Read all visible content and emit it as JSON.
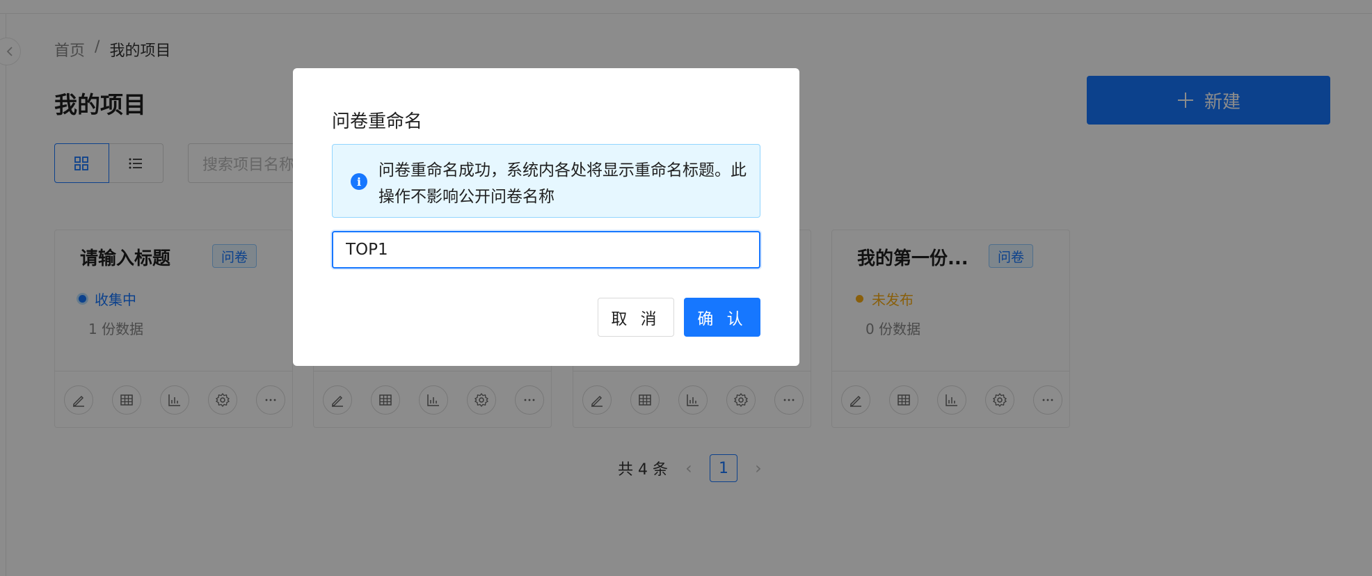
{
  "breadcrumb": {
    "home": "首页",
    "separator": "/",
    "current": "我的项目"
  },
  "page": {
    "title": "我的项目",
    "new_button": "新建"
  },
  "search": {
    "placeholder": "搜索项目名称"
  },
  "colors": {
    "primary": "#1677ff",
    "collecting": "#1677ff",
    "unpublished": "#faad14"
  },
  "cards": [
    {
      "title": "请输入标题",
      "tag": "问卷",
      "status": "收集中",
      "count": "1 份数据"
    },
    {
      "title": "",
      "tag": "",
      "status": "",
      "count": ""
    },
    {
      "title": "",
      "tag": "",
      "status": "",
      "count": ""
    },
    {
      "title": "我的第一份...",
      "tag": "问卷",
      "status": "未发布",
      "count": "0 份数据"
    }
  ],
  "pagination": {
    "total": "共 4 条",
    "current_page": "1"
  },
  "modal": {
    "title": "问卷重命名",
    "alert": "问卷重命名成功，系统内各处将显示重命名标题。此操作不影响公开问卷名称",
    "input_value": "TOP1",
    "cancel": "取 消",
    "confirm": "确 认"
  }
}
